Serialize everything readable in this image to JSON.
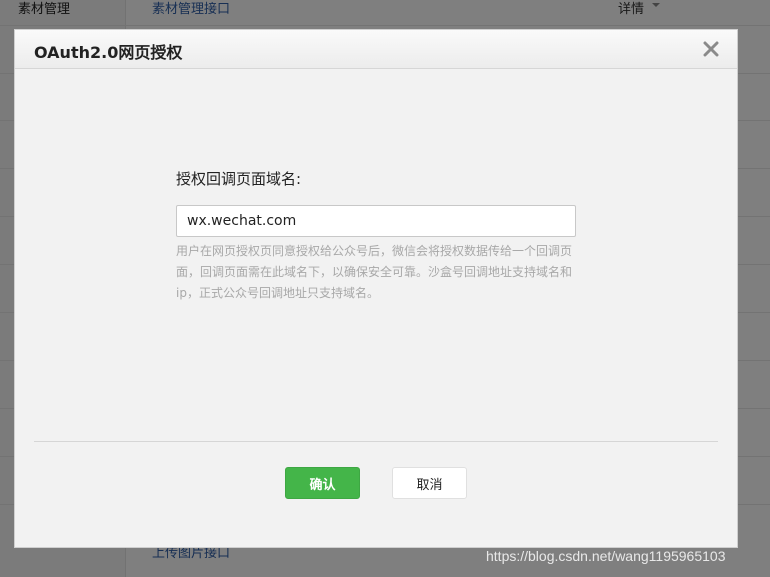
{
  "background": {
    "left_label": "素材管理",
    "top_link": "素材管理接口",
    "detail_label": "详情",
    "bottom_link": "上传图片接口"
  },
  "dialog": {
    "title": "OAuth2.0网页授权",
    "field_label": "授权回调页面域名:",
    "domain_value": "wx.wechat.com",
    "help_text": "用户在网页授权页同意授权给公众号后，微信会将授权数据传给一个回调页面，回调页面需在此域名下，以确保安全可靠。沙盒号回调地址支持域名和ip，正式公众号回调地址只支持域名。",
    "confirm_label": "确认",
    "cancel_label": "取消"
  },
  "watermark": "https://blog.csdn.net/wang1195965103",
  "colors": {
    "primary_button": "#44b549",
    "link": "#2f5fa8",
    "help_text": "#a8a8a8"
  },
  "icons": {
    "close": "close-icon",
    "detail_caret": "caret-down-icon"
  }
}
